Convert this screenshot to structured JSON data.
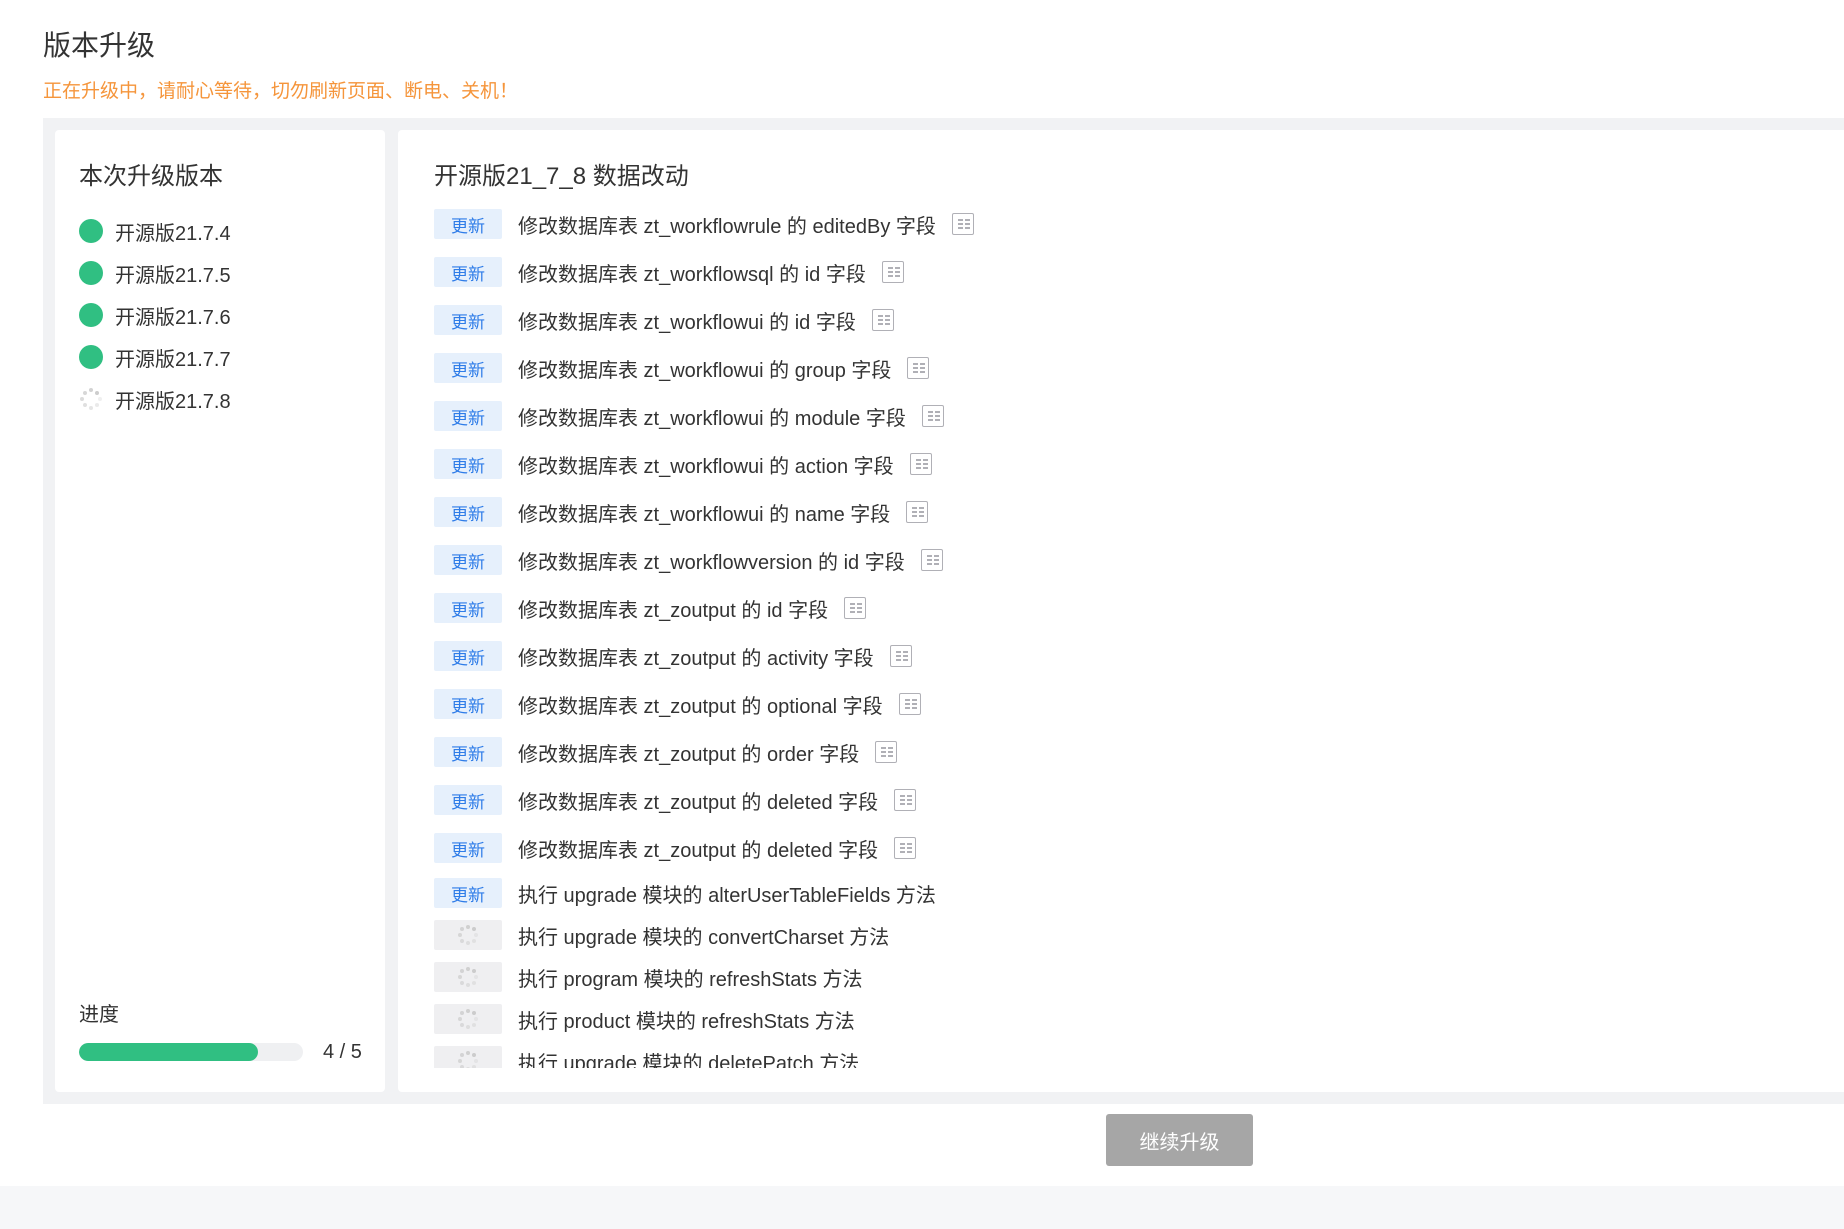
{
  "header": {
    "title": "版本升级",
    "warning": "正在升级中，请耐心等待，切勿刷新页面、断电、关机！"
  },
  "versions_panel": {
    "title": "本次升级版本",
    "items": [
      {
        "label": "开源版21.7.4",
        "status": "done"
      },
      {
        "label": "开源版21.7.5",
        "status": "done"
      },
      {
        "label": "开源版21.7.6",
        "status": "done"
      },
      {
        "label": "开源版21.7.7",
        "status": "done"
      },
      {
        "label": "开源版21.7.8",
        "status": "loading"
      }
    ],
    "progress_label": "进度",
    "progress_fraction": 0.8,
    "progress_text": "4 / 5"
  },
  "log_panel": {
    "title": "开源版21_7_8 数据改动",
    "update_tag": "更新",
    "rows": [
      {
        "status": "update",
        "text": "修改数据库表 zt_workflowrule 的 editedBy 字段",
        "has_doc": true
      },
      {
        "status": "update",
        "text": "修改数据库表 zt_workflowsql 的 id 字段",
        "has_doc": true
      },
      {
        "status": "update",
        "text": "修改数据库表 zt_workflowui 的 id 字段",
        "has_doc": true
      },
      {
        "status": "update",
        "text": "修改数据库表 zt_workflowui 的 group 字段",
        "has_doc": true
      },
      {
        "status": "update",
        "text": "修改数据库表 zt_workflowui 的 module 字段",
        "has_doc": true
      },
      {
        "status": "update",
        "text": "修改数据库表 zt_workflowui 的 action 字段",
        "has_doc": true
      },
      {
        "status": "update",
        "text": "修改数据库表 zt_workflowui 的 name 字段",
        "has_doc": true
      },
      {
        "status": "update",
        "text": "修改数据库表 zt_workflowversion 的 id 字段",
        "has_doc": true
      },
      {
        "status": "update",
        "text": "修改数据库表 zt_zoutput 的 id 字段",
        "has_doc": true
      },
      {
        "status": "update",
        "text": "修改数据库表 zt_zoutput 的 activity 字段",
        "has_doc": true
      },
      {
        "status": "update",
        "text": "修改数据库表 zt_zoutput 的 optional 字段",
        "has_doc": true
      },
      {
        "status": "update",
        "text": "修改数据库表 zt_zoutput 的 order 字段",
        "has_doc": true
      },
      {
        "status": "update",
        "text": "修改数据库表 zt_zoutput 的 deleted 字段",
        "has_doc": true
      },
      {
        "status": "update",
        "text": "修改数据库表 zt_zoutput 的 deleted 字段",
        "has_doc": true
      },
      {
        "status": "update",
        "text": "执行 upgrade 模块的 alterUserTableFields 方法",
        "has_doc": false
      },
      {
        "status": "pending",
        "text": "执行 upgrade 模块的 convertCharset 方法",
        "has_doc": false
      },
      {
        "status": "pending",
        "text": "执行 program 模块的 refreshStats 方法",
        "has_doc": false
      },
      {
        "status": "pending",
        "text": "执行 product 模块的 refreshStats 方法",
        "has_doc": false
      },
      {
        "status": "pending",
        "text": "执行 upgrade 模块的 deletePatch 方法",
        "has_doc": false
      }
    ]
  },
  "footer": {
    "continue_label": "继续升级",
    "continue_enabled": false
  },
  "colors": {
    "success": "#30bf82",
    "warning": "#f5953b",
    "tag_bg": "#e6f0fc",
    "tag_text": "#2e7ce8",
    "button_disabled": "#a6a6a6"
  }
}
